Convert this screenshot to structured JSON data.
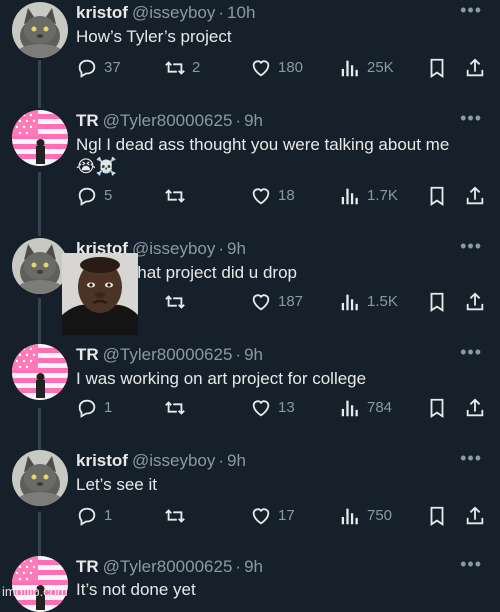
{
  "colors": {
    "background": "#15202b",
    "text": "#e7e9ea",
    "muted": "#8b98a5",
    "line": "#38444d"
  },
  "watermark": "imgflip.com",
  "tweets": [
    {
      "name": "kristof",
      "handle": "@isseyboy",
      "time": "10h",
      "text": "How’s Tyler’s project",
      "replies": "37",
      "retweets": "2",
      "likes": "180",
      "views": "25K",
      "avatar": "cat-avatar"
    },
    {
      "name": "TR",
      "handle": "@Tyler80000625",
      "time": "9h",
      "text": "Ngl I dead ass thought you were talking about me",
      "emoji": "😭☠️",
      "replies": "5",
      "retweets": "",
      "likes": "18",
      "views": "1.7K",
      "avatar": "flag-avatar"
    },
    {
      "name": "kristof",
      "handle": "@isseyboy",
      "time": "9h",
      "text": "what project did u drop",
      "replies": "",
      "retweets": "",
      "likes": "187",
      "views": "1.5K",
      "avatar": "cat-avatar"
    },
    {
      "name": "TR",
      "handle": "@Tyler80000625",
      "time": "9h",
      "text": "I was working on art project for college",
      "replies": "1",
      "retweets": "",
      "likes": "13",
      "views": "784",
      "avatar": "flag-avatar"
    },
    {
      "name": "kristof",
      "handle": "@isseyboy",
      "time": "9h",
      "text": "Let’s see it",
      "replies": "1",
      "retweets": "",
      "likes": "17",
      "views": "750",
      "avatar": "cat-avatar"
    },
    {
      "name": "TR",
      "handle": "@Tyler80000625",
      "time": "9h",
      "text": "It’s not done yet",
      "avatar": "flag-avatar"
    }
  ]
}
